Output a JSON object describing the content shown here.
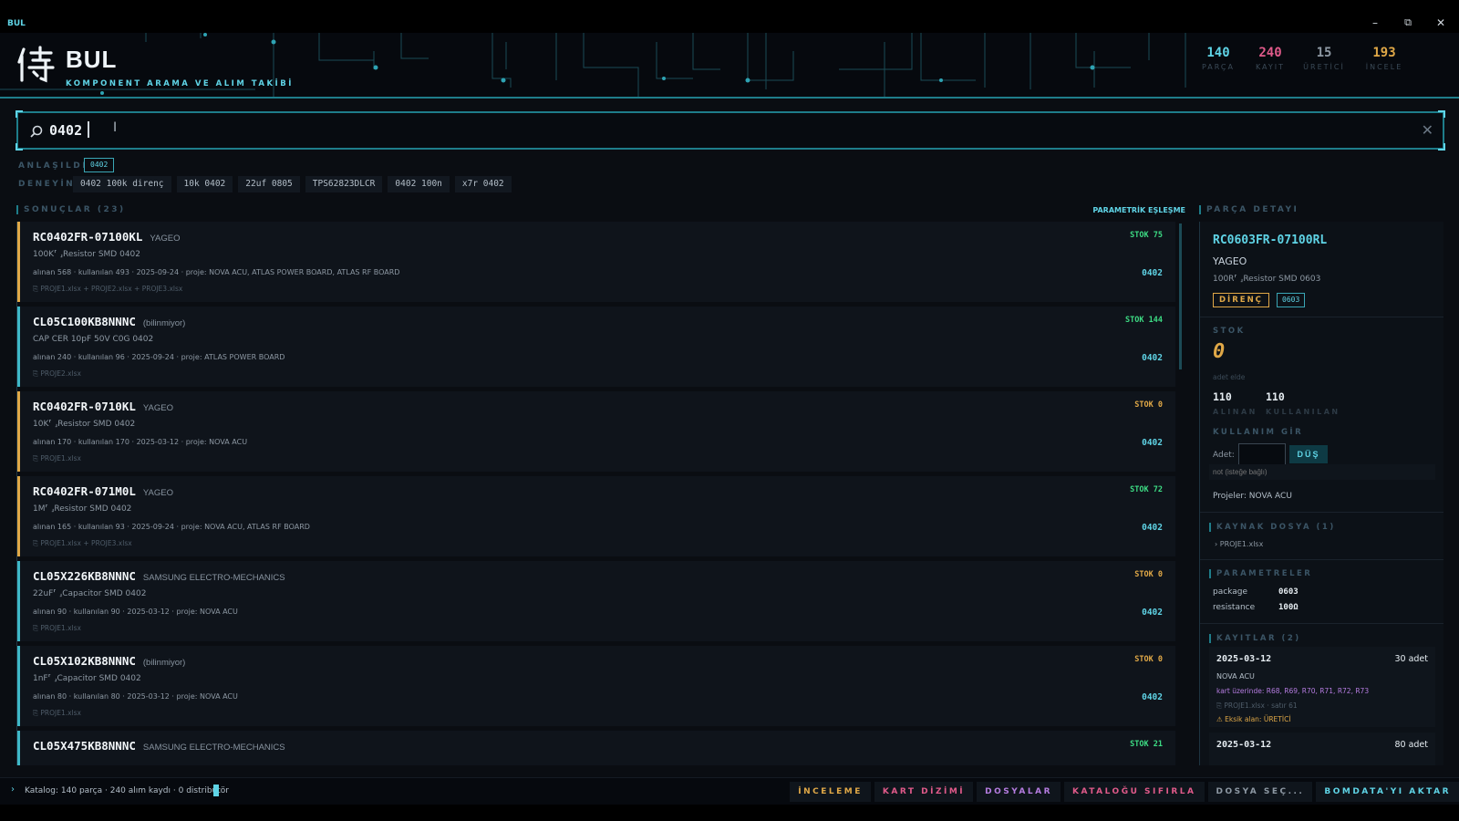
{
  "window": {
    "title": "BUL",
    "minimize": "–",
    "maximize": "⧉",
    "close": "✕"
  },
  "header": {
    "title": "BUL",
    "subtitle": "KOMPONENT ARAMA VE ALIM TAKİBİ",
    "stats": [
      {
        "value": "140",
        "label": "PARÇA",
        "color": "#5fd4e6"
      },
      {
        "value": "240",
        "label": "KAYIT",
        "color": "#e05a8a"
      },
      {
        "value": "15",
        "label": "ÜRETİCİ",
        "color": "#8d98a3"
      },
      {
        "value": "193",
        "label": "İNCELE",
        "color": "#e0a847"
      }
    ]
  },
  "search": {
    "value": "0402",
    "clear": "✕"
  },
  "understood": {
    "label": "ANLAŞILDI",
    "tag": "0402"
  },
  "try": {
    "label": "DENEYİN",
    "suggestions": [
      "0402 100k direnç",
      "10k 0402",
      "22uf 0805",
      "TPS62823DLCR",
      "0402 100n",
      "x7r 0402"
    ]
  },
  "results": {
    "title": "SONUÇLAR (23)",
    "param_match": "PARAMETRİK EŞLEŞME",
    "items": [
      {
        "pn": "RC0402FR-07100KL",
        "mf": "YAGEO",
        "desc": "100K⸢ ⸥Resistor SMD 0402",
        "meta": "alınan 568  ·  kullanılan 493  ·  2025-09-24  ·  proje: NOVA ACU, ATLAS POWER BOARD, ATLAS RF BOARD",
        "files": "⎘ PROJE1.xlsx  +  PROJE2.xlsx  +  PROJE3.xlsx",
        "stock": "STOK 75",
        "stock_color": "#3ddc84",
        "pkg": "0402",
        "accent": "#e0a847"
      },
      {
        "pn": "CL05C100KB8NNNC",
        "mf": "(bilinmiyor)",
        "desc": "CAP CER 10pF 50V C0G 0402",
        "meta": "alınan 240  ·  kullanılan 96  ·  2025-09-24  ·  proje: ATLAS POWER BOARD",
        "files": "⎘ PROJE2.xlsx",
        "stock": "STOK 144",
        "stock_color": "#3ddc84",
        "pkg": "0402",
        "accent": "#3fb8c8"
      },
      {
        "pn": "RC0402FR-0710KL",
        "mf": "YAGEO",
        "desc": "10K⸢ ⸥Resistor SMD 0402",
        "meta": "alınan 170  ·  kullanılan 170  ·  2025-03-12  ·  proje: NOVA ACU",
        "files": "⎘ PROJE1.xlsx",
        "stock": "STOK 0",
        "stock_color": "#e0a847",
        "pkg": "0402",
        "accent": "#e0a847"
      },
      {
        "pn": "RC0402FR-071M0L",
        "mf": "YAGEO",
        "desc": "1M⸢ ⸥Resistor SMD 0402",
        "meta": "alınan 165  ·  kullanılan 93  ·  2025-09-24  ·  proje: NOVA ACU, ATLAS RF BOARD",
        "files": "⎘ PROJE1.xlsx  +  PROJE3.xlsx",
        "stock": "STOK 72",
        "stock_color": "#3ddc84",
        "pkg": "0402",
        "accent": "#e0a847"
      },
      {
        "pn": "CL05X226KB8NNNC",
        "mf": "SAMSUNG ELECTRO-MECHANICS",
        "desc": "22uF⸢ ⸥Capacitor SMD 0402",
        "meta": "alınan 90  ·  kullanılan 90  ·  2025-03-12  ·  proje: NOVA ACU",
        "files": "⎘ PROJE1.xlsx",
        "stock": "STOK 0",
        "stock_color": "#e0a847",
        "pkg": "0402",
        "accent": "#3fb8c8"
      },
      {
        "pn": "CL05X102KB8NNNC",
        "mf": "(bilinmiyor)",
        "desc": "1nF⸢ ⸥Capacitor SMD 0402",
        "meta": "alınan 80  ·  kullanılan 80  ·  2025-03-12  ·  proje: NOVA ACU",
        "files": "⎘ PROJE1.xlsx",
        "stock": "STOK 0",
        "stock_color": "#e0a847",
        "pkg": "0402",
        "accent": "#3fb8c8"
      },
      {
        "pn": "CL05X475KB8NNNC",
        "mf": "SAMSUNG ELECTRO-MECHANICS",
        "desc": "",
        "meta": "",
        "files": "",
        "stock": "STOK 21",
        "stock_color": "#3ddc84",
        "pkg": "",
        "accent": "#3fb8c8"
      }
    ]
  },
  "detail": {
    "title": "PARÇA DETAYI",
    "pn": "RC0603FR-07100RL",
    "mf": "YAGEO",
    "desc": "100R⸢ ⸥Resistor SMD 0603",
    "tag_type": "DİRENÇ",
    "tag_pkg": "0603",
    "stock_label": "STOK",
    "stock_value": "0",
    "stock_sub": "adet elde",
    "received": "110",
    "received_label": "ALINAN",
    "used": "110",
    "used_label": "KULLANILAN",
    "usage_label": "KULLANIM GİR",
    "qty_label": "Adet:",
    "drop_btn": "DÜŞ",
    "note_placeholder": "not (isteğe bağlı)",
    "projects": "Projeler: NOVA ACU",
    "source_label": "KAYNAK DOSYA (1)",
    "source_file": "›  PROJE1.xlsx",
    "params_label": "PARAMETRELER",
    "params": [
      {
        "k": "package",
        "v": "0603"
      },
      {
        "k": "resistance",
        "v": "100Ω"
      }
    ],
    "records_label": "KAYITLAR (2)",
    "records": [
      {
        "date": "2025-03-12",
        "qty": "30 adet",
        "project": "NOVA ACU",
        "kart": "kart üzerinde: R68, R69, R70, R71, R72, R73",
        "file": "⎘ PROJE1.xlsx  ·  satır 61",
        "warn": "⚠  Eksik alan: ÜRETİCİ"
      },
      {
        "date": "2025-03-12",
        "qty": "80 adet"
      }
    ]
  },
  "status": {
    "text": "Katalog: 140 parça · 240 alım kaydı · 0 distribütör"
  },
  "footer": [
    {
      "label": "İNCELEME",
      "color": "#e0a847"
    },
    {
      "label": "KART DİZİMİ",
      "color": "#e05a8a"
    },
    {
      "label": "DOSYALAR",
      "color": "#b57ce0"
    },
    {
      "label": "KATALOĞU SIFIRLA",
      "color": "#e05a8a"
    },
    {
      "label": "DOSYA SEÇ...",
      "color": "#8d98a3"
    },
    {
      "label": "BOMDATA'YI AKTAR",
      "color": "#5fd4e6"
    }
  ]
}
